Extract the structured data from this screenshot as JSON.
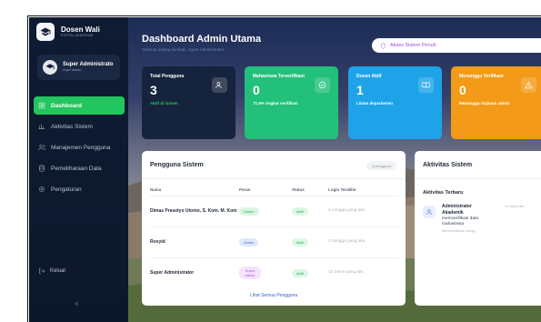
{
  "brand": {
    "title": "Dosen Wali",
    "subtitle": "PORTAL AKADEMIK"
  },
  "user": {
    "name": "Super Administrato",
    "role": "Super Admin"
  },
  "nav": [
    {
      "label": "Dashboard",
      "icon": "grid-icon",
      "active": true
    },
    {
      "label": "Aktivitas Sistem",
      "icon": "bar-chart-icon"
    },
    {
      "label": "Manajemen Pengguna",
      "icon": "users-icon"
    },
    {
      "label": "Pemeliharaan Data",
      "icon": "database-icon"
    },
    {
      "label": "Pengaturan",
      "icon": "gear-icon"
    }
  ],
  "logout_label": "Keluar",
  "collapse_glyph": "«",
  "header": {
    "title": "Dashboard Admin Utama",
    "subtitle": "Selamat datang kembali, Super Administrator",
    "access_label": "Akses Sistem Penuh"
  },
  "cards": [
    {
      "label": "Total Pengguna",
      "value": "3",
      "note": "Aktif di sistem",
      "icon": "users-icon"
    },
    {
      "label": "Mahasiswa Terverifikasi",
      "value": "0",
      "note": "71.5% tingkat verifikasi",
      "icon": "check-circle-icon"
    },
    {
      "label": "Dosen Aktif",
      "value": "1",
      "note": "Lintas departemen",
      "icon": "book-icon"
    },
    {
      "label": "Menunggu Verifikasi",
      "value": "0",
      "note": "Menunggu tinjauan admin",
      "icon": "warning-icon"
    }
  ],
  "users_panel": {
    "title": "Pengguna Sistem",
    "count_badge": "3 pengguna",
    "columns": [
      "Nama",
      "Peran",
      "Status",
      "Login Terakhir"
    ],
    "rows": [
      {
        "name": "Dimas Prasetyo Utomo, S. Kom. M. Kom",
        "role": "Dosen",
        "status": "Aktif",
        "last_login": "3 minggu yang lalu"
      },
      {
        "name": "Rosyid",
        "role": "Admin",
        "status": "Aktif",
        "last_login": "3 minggu yang lalu"
      },
      {
        "name": "Super Administrator",
        "role": "Super admin",
        "status": "Aktif",
        "last_login": "12 menit yang lalu"
      }
    ],
    "see_all": "Lihat Semua Pengguna"
  },
  "activity_panel": {
    "title": "Aktivitas Sistem",
    "section": "Aktivitas Terbaru",
    "items": [
      {
        "actor": "Administrator Akademik",
        "description": "memverifikasi data mahasiswa",
        "more": "Memverifikasi orang...",
        "time": "6 menit lalu"
      }
    ]
  },
  "colors": {
    "sidebar": "#0f1b33",
    "accent_green": "#22c55e",
    "card_dark": "#16233c",
    "card_green": "#22c07a",
    "card_blue": "#1ea3e8",
    "card_orange": "#f39a18",
    "purple": "#9b4bd6"
  }
}
